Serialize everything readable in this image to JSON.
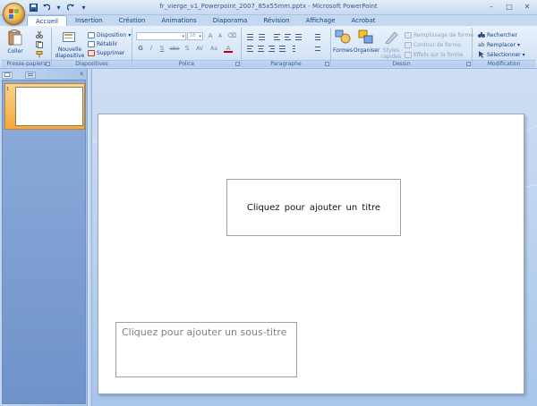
{
  "window": {
    "title": "fr_vierge_v1_Powerpoint_2007_85x55mm.pptx - Microsoft PowerPoint",
    "controls": [
      "–",
      "□",
      "✕"
    ]
  },
  "tabs": [
    "Accueil",
    "Insertion",
    "Création",
    "Animations",
    "Diaporama",
    "Révision",
    "Affichage",
    "Acrobat"
  ],
  "active_tab": "Accueil",
  "ribbon": {
    "clipboard": {
      "paste_label": "Coller",
      "group_label": "Presse-papiers"
    },
    "slides": {
      "new_slide_label_1": "Nouvelle",
      "new_slide_label_2": "diapositive",
      "layout": "Disposition",
      "reset": "Rétablir",
      "delete": "Supprimer",
      "group_label": "Diapositives"
    },
    "font": {
      "font_name": "",
      "font_size": "18",
      "grow": "A",
      "shrink": "A",
      "bold": "G",
      "italic": "I",
      "underline": "S",
      "strike": "abe",
      "shadow": "S",
      "spacing": "AV",
      "case": "Aa",
      "color": "A",
      "group_label": "Police"
    },
    "paragraph": {
      "group_label": "Paragraphe"
    },
    "drawing": {
      "shapes": "Formes",
      "arrange": "Organiser",
      "quick_styles_1": "Styles",
      "quick_styles_2": "rapides",
      "fill": "Remplissage de forme",
      "outline": "Contour de forme",
      "effects": "Effets sur la forme",
      "group_label": "Dessin"
    },
    "editing": {
      "find": "Rechercher",
      "replace": "Remplacer",
      "select": "Sélectionner",
      "group_label": "Modification"
    }
  },
  "slide_panel": {
    "slide_number": "1",
    "close": "x"
  },
  "slide": {
    "title_placeholder": "Cliquez pour ajouter un titre",
    "subtitle_placeholder": "Cliquez pour ajouter un sous-titre"
  },
  "colors": {
    "ribbon_bg": "#dae7f7",
    "accent_blue": "#15428b",
    "selection_orange": "#f4a73b"
  }
}
